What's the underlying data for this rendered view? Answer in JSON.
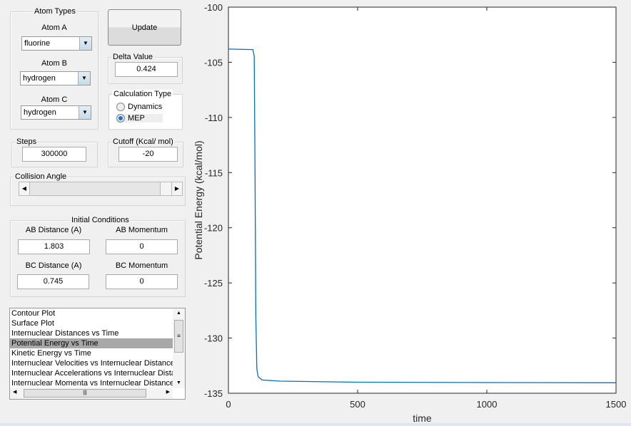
{
  "atom_types": {
    "title": "Atom Types",
    "atom_a_label": "Atom A",
    "atom_a": "fluorine",
    "atom_b_label": "Atom B",
    "atom_b": "hydrogen",
    "atom_c_label": "Atom C",
    "atom_c": "hydrogen"
  },
  "update_label": "Update",
  "delta": {
    "title": "Delta Value",
    "value": "0.424"
  },
  "calc": {
    "title": "Calculation Type",
    "options": [
      "Dynamics",
      "MEP"
    ],
    "selected": "MEP"
  },
  "steps": {
    "title": "Steps",
    "value": "300000"
  },
  "cutoff": {
    "title": "Cutoff (Kcal/ mol)",
    "value": "-20"
  },
  "collision": {
    "title": "Collision Angle"
  },
  "initial": {
    "title": "Initial Conditions",
    "ab_dist_label": "AB Distance (A)",
    "ab_dist": "1.803",
    "ab_mom_label": "AB Momentum",
    "ab_mom": "0",
    "bc_dist_label": "BC Distance (A)",
    "bc_dist": "0.745",
    "bc_mom_label": "BC Momentum",
    "bc_mom": "0"
  },
  "plot_list": {
    "items": [
      "Contour Plot",
      "Surface Plot",
      "Internuclear Distances vs Time",
      "Potential Energy vs Time",
      "Kinetic Energy vs Time",
      "Internuclear Velocities vs Internuclear Distance",
      "Internuclear Accelerations vs Internuclear Distance",
      "Internuclear Momenta vs Internuclear Distance"
    ],
    "selected_index": 3
  },
  "chart_data": {
    "type": "line",
    "xlabel": "time",
    "ylabel": "Potential Energy (kcal/mol)",
    "xlim": [
      0,
      1500
    ],
    "ylim": [
      -135,
      -100
    ],
    "xticks": [
      0,
      500,
      1000,
      1500
    ],
    "yticks": [
      -100,
      -105,
      -110,
      -115,
      -120,
      -125,
      -130,
      -135
    ],
    "grid": false,
    "color": "#0072bd",
    "series": [
      {
        "x": [
          0,
          95,
          100,
          103,
          106,
          110,
          115,
          130,
          200,
          500,
          1000,
          1500
        ],
        "y": [
          -103.8,
          -103.85,
          -104.5,
          -115,
          -128,
          -132.8,
          -133.5,
          -133.8,
          -133.9,
          -134.0,
          -134.03,
          -134.05
        ]
      }
    ]
  }
}
